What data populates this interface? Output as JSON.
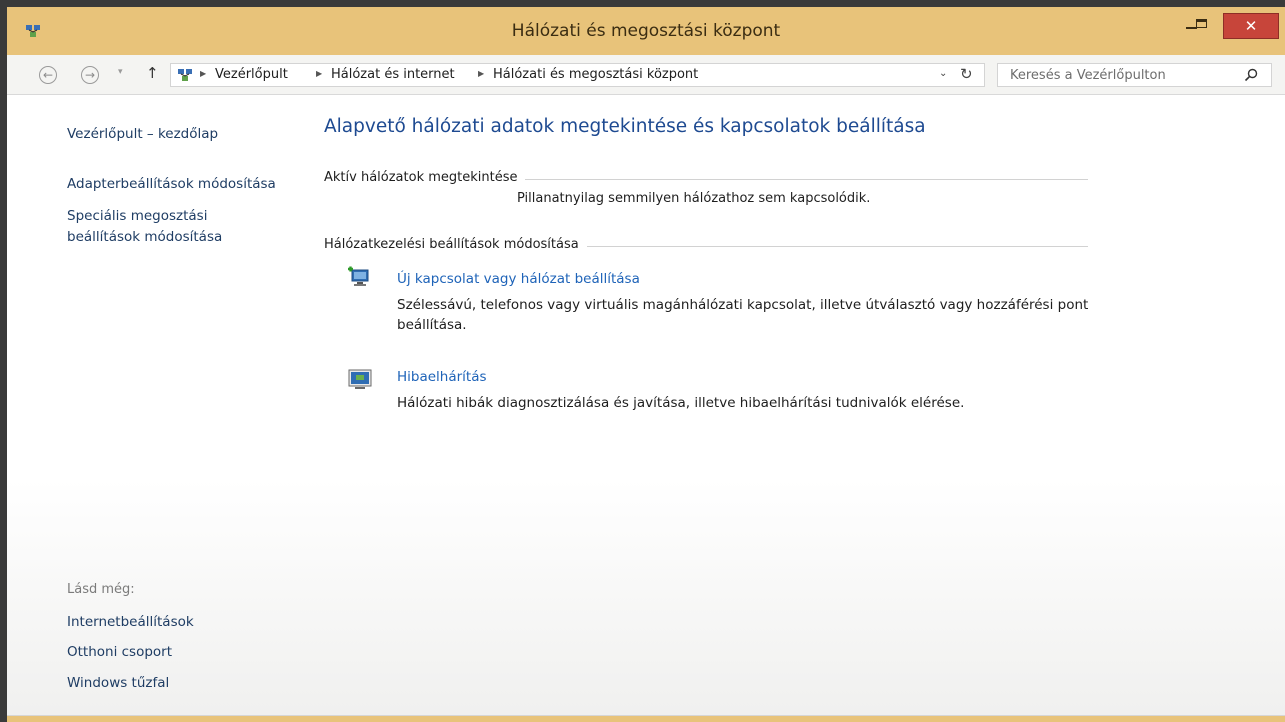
{
  "window": {
    "title": "Hálózati és megosztási központ",
    "close_glyph": "✕"
  },
  "nav": {
    "back_glyph": "←",
    "forward_glyph": "→",
    "recent_glyph": "▾",
    "up_glyph": "↑",
    "breadcrumbs": [
      "Vezérlőpult",
      "Hálózat és internet",
      "Hálózati és megosztási központ"
    ],
    "dropdown_glyph": "⌄",
    "refresh_glyph": "↻",
    "search_placeholder": "Keresés a Vezérlőpulton"
  },
  "sidebar": {
    "home_link": "Vezérlőpult – kezdőlap",
    "adapter_link": "Adapterbeállítások módosítása",
    "sharing_link_line1": "Speciális megosztási",
    "sharing_link_line2": "beállítások módosítása",
    "see_also_label": "Lásd még:",
    "see_also": [
      "Internetbeállítások",
      "Otthoni csoport",
      "Windows tűzfal"
    ]
  },
  "main": {
    "heading": "Alapvető hálózati adatok megtekintése és kapcsolatok beállítása",
    "active_section": "Aktív hálózatok megtekintése",
    "no_network": "Pillanatnyilag semmilyen hálózathoz sem kapcsolódik.",
    "settings_section": "Hálózatkezelési beállítások módosítása",
    "tasks": [
      {
        "title": "Új kapcsolat vagy hálózat beállítása",
        "desc": "Szélessávú, telefonos vagy virtuális magánhálózati kapcsolat, illetve útválasztó vagy hozzáférési pont beállítása."
      },
      {
        "title": "Hibaelhárítás",
        "desc": "Hálózati hibák diagnosztizálása és javítása, illetve hibaelhárítási tudnivalók elérése."
      }
    ]
  },
  "colors": {
    "titlebar": "#e8c37a",
    "close_button": "#c7453a",
    "heading": "#1e4a91",
    "link": "#1e63b8"
  },
  "icons": {
    "app": "network-control-panel-icon",
    "new_connection": "new-connection-icon",
    "troubleshoot": "troubleshoot-icon",
    "search": "search-icon"
  }
}
